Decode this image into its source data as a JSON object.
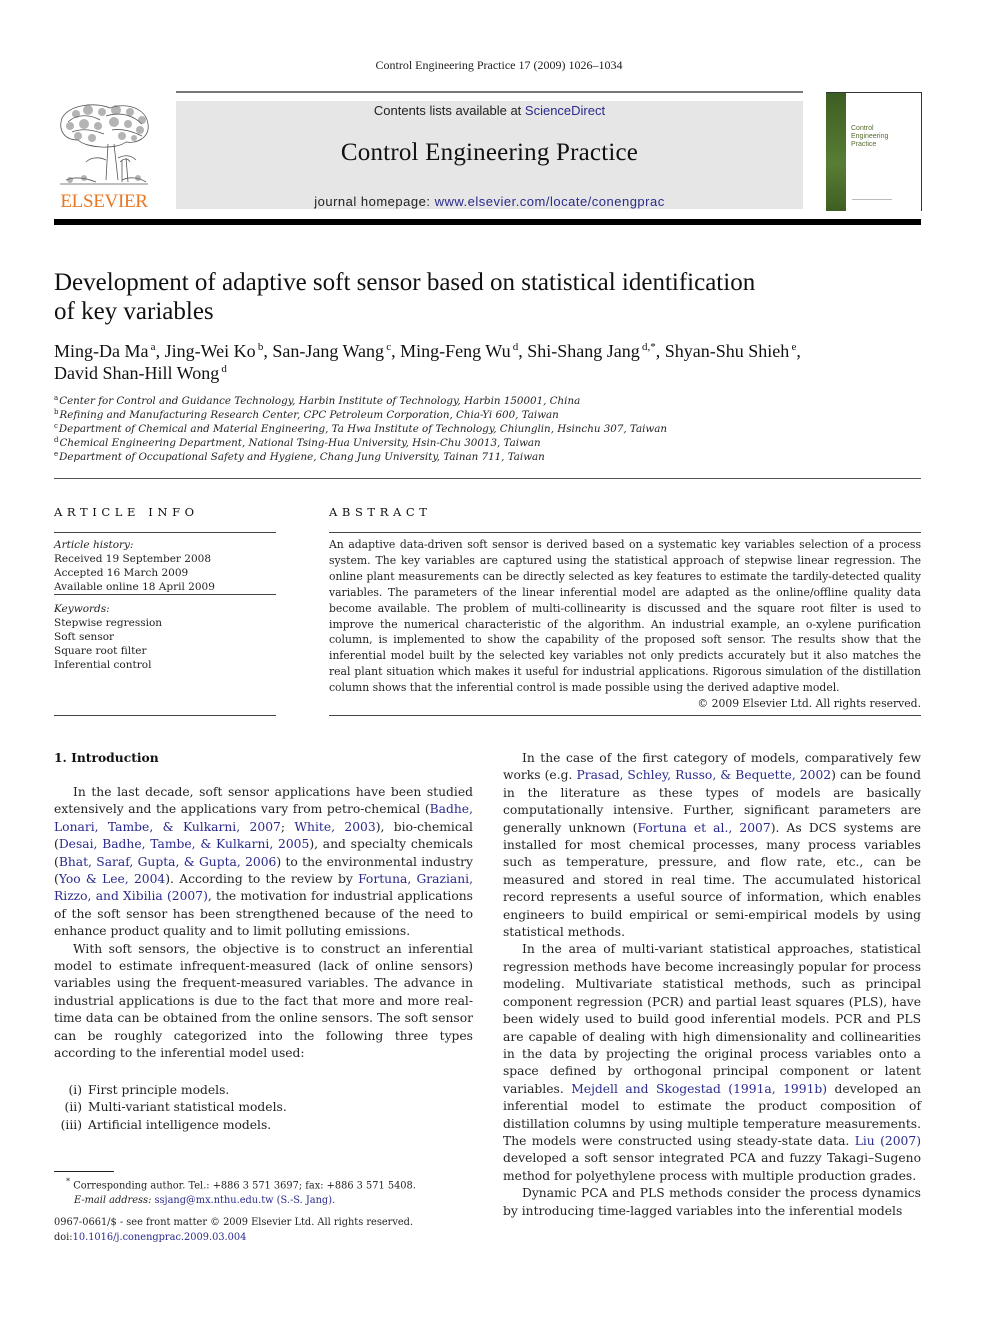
{
  "running_head": "Control Engineering Practice 17 (2009) 1026–1034",
  "banner": {
    "contents_prefix": "Contents lists available at ",
    "contents_link": "ScienceDirect",
    "journal_title": "Control Engineering Practice",
    "homepage_prefix": "journal homepage: ",
    "homepage_link": "www.elsevier.com/locate/conengprac"
  },
  "logo": {
    "publisher": "ELSEVIER",
    "icon": "elsevier-tree-icon",
    "color": "#e87722"
  },
  "cover": {
    "title_lines": [
      "Control",
      "Engineering",
      "Practice"
    ],
    "accent_color": "#4a6d2a"
  },
  "article": {
    "title_line1": "Development of adaptive soft sensor based on statistical identification",
    "title_line2": "of key variables",
    "authors": [
      {
        "name": "Ming-Da Ma",
        "sup": "a",
        "sep": ", "
      },
      {
        "name": "Jing-Wei Ko",
        "sup": "b",
        "sep": ", "
      },
      {
        "name": "San-Jang Wang",
        "sup": "c",
        "sep": ", "
      },
      {
        "name": "Ming-Feng Wu",
        "sup": "d",
        "sep": ", "
      },
      {
        "name": "Shi-Shang Jang",
        "sup": "d,*",
        "sep": ", "
      },
      {
        "name": "Shyan-Shu Shieh",
        "sup": "e",
        "sep": ","
      },
      {
        "name": "David Shan-Hill Wong",
        "sup": "d",
        "sep": ""
      }
    ],
    "affiliations": [
      {
        "sup": "a",
        "text": "Center for Control and Guidance Technology, Harbin Institute of Technology, Harbin 150001, China"
      },
      {
        "sup": "b",
        "text": "Refining and Manufacturing Research Center, CPC Petroleum Corporation, Chia-Yi 600, Taiwan"
      },
      {
        "sup": "c",
        "text": "Department of Chemical and Material Engineering, Ta Hwa Institute of Technology, Chiunglin, Hsinchu 307, Taiwan"
      },
      {
        "sup": "d",
        "text": "Chemical Engineering Department, National Tsing-Hua University, Hsin-Chu 30013, Taiwan"
      },
      {
        "sup": "e",
        "text": "Department of Occupational Safety and Hygiene, Chang Jung University, Tainan 711, Taiwan"
      }
    ]
  },
  "article_info": {
    "heading": "ARTICLE INFO",
    "history_label": "Article history:",
    "history": [
      "Received 19 September 2008",
      "Accepted 16 March 2009",
      "Available online 18 April 2009"
    ],
    "keywords_label": "Keywords:",
    "keywords": [
      "Stepwise regression",
      "Soft sensor",
      "Square root filter",
      "Inferential control"
    ]
  },
  "abstract": {
    "heading": "ABSTRACT",
    "text": "An adaptive data-driven soft sensor is derived based on a systematic key variables selection of a process system. The key variables are captured using the statistical approach of stepwise linear regression. The online plant measurements can be directly selected as key features to estimate the tardily-detected quality variables. The parameters of the linear inferential model are adapted as the online/offline quality data become available. The problem of multi-collinearity is discussed and the square root filter is used to improve the numerical characteristic of the algorithm. An industrial example, an o-xylene purification column, is implemented to show the capability of the proposed soft sensor. The results show that the inferential model built by the selected key variables not only predicts accurately but it also matches the real plant situation which makes it useful for industrial applications. Rigorous simulation of the distillation column shows that the inferential control is made possible using the derived adaptive model.",
    "copyright": "© 2009 Elsevier Ltd. All rights reserved."
  },
  "intro": {
    "heading": "1.  Introduction",
    "p1": [
      {
        "t": "In the last decade, soft sensor applications have been studied extensively and the applications vary from petro-chemical ("
      },
      {
        "l": "Badhe, Lonari, Tambe, & Kulkarni, 2007"
      },
      {
        "t": "; "
      },
      {
        "l": "White, 2003"
      },
      {
        "t": "), bio-chemical ("
      },
      {
        "l": "Desai, Badhe, Tambe, & Kulkarni, 2005"
      },
      {
        "t": "), and specialty chemicals ("
      },
      {
        "l": "Bhat, Saraf, Gupta, & Gupta, 2006"
      },
      {
        "t": ") to the environmental industry ("
      },
      {
        "l": "Yoo & Lee, 2004"
      },
      {
        "t": "). According to the review by "
      },
      {
        "l": "Fortuna, Graziani, Rizzo, and Xibilia (2007)"
      },
      {
        "t": ", the motivation for industrial applications of the soft sensor has been strengthened because of the need to enhance product quality and to limit polluting emissions."
      }
    ],
    "p2": "With soft sensors, the objective is to construct an inferential model to estimate infrequent-measured (lack of online sensors) variables using the frequent-measured variables. The advance in industrial applications is due to the fact that more and more real-time data can be obtained from the online sensors. The soft sensor can be roughly categorized into the following three types according to the inferential model used:",
    "list": [
      {
        "num": "(i)",
        "text": "First principle models."
      },
      {
        "num": "(ii)",
        "text": "Multi-variant statistical models."
      },
      {
        "num": "(iii)",
        "text": "Artificial intelligence models."
      }
    ],
    "right_p1": [
      {
        "t": "In the case of the first category of models, comparatively few works (e.g. "
      },
      {
        "l": "Prasad, Schley, Russo, & Bequette, 2002"
      },
      {
        "t": ") can be found in the literature as these types of models are basically computationally intensive. Further, significant parameters are generally unknown ("
      },
      {
        "l": "Fortuna et al., 2007"
      },
      {
        "t": "). As DCS systems are installed for most chemical processes, many process variables such as temperature, pressure, and flow rate, etc., can be measured and stored in real time. The accumulated historical record represents a useful source of information, which enables engineers to build empirical or semi-empirical models by using statistical methods."
      }
    ],
    "right_p2": [
      {
        "t": "In the area of multi-variant statistical approaches, statistical regression methods have become increasingly popular for process modeling. Multivariate statistical methods, such as principal component regression (PCR) and partial least squares (PLS), have been widely used to build good inferential models. PCR and PLS are capable of dealing with high dimensionality and collinearities in the data by projecting the original process variables onto a space defined by orthogonal principal component or latent variables. "
      },
      {
        "l": "Mejdell and Skogestad (1991a, 1991b)"
      },
      {
        "t": " developed an inferential model to estimate the product composition of distillation columns by using multiple temperature measurements. The models were constructed using steady-state data. "
      },
      {
        "l": "Liu (2007)"
      },
      {
        "t": " developed a soft sensor integrated PCA and fuzzy Takagi–Sugeno method for polyethylene process with multiple production grades."
      }
    ],
    "right_p3": "Dynamic PCA and PLS methods consider the process dynamics by introducing time-lagged variables into the inferential models"
  },
  "footnote": {
    "star": "*",
    "corresponding": " Corresponding author. Tel.: +886 3 571 3697; fax: +886 3 571 5408.",
    "email_label": "E-mail address: ",
    "email_link": "ssjang@mx.nthu.edu.tw (S.-S. Jang).",
    "frontmatter": "0967-0661/$ - see front matter © 2009 Elsevier Ltd. All rights reserved.",
    "doi_prefix": "doi:",
    "doi_link": "10.1016/j.conengprac.2009.03.004"
  }
}
